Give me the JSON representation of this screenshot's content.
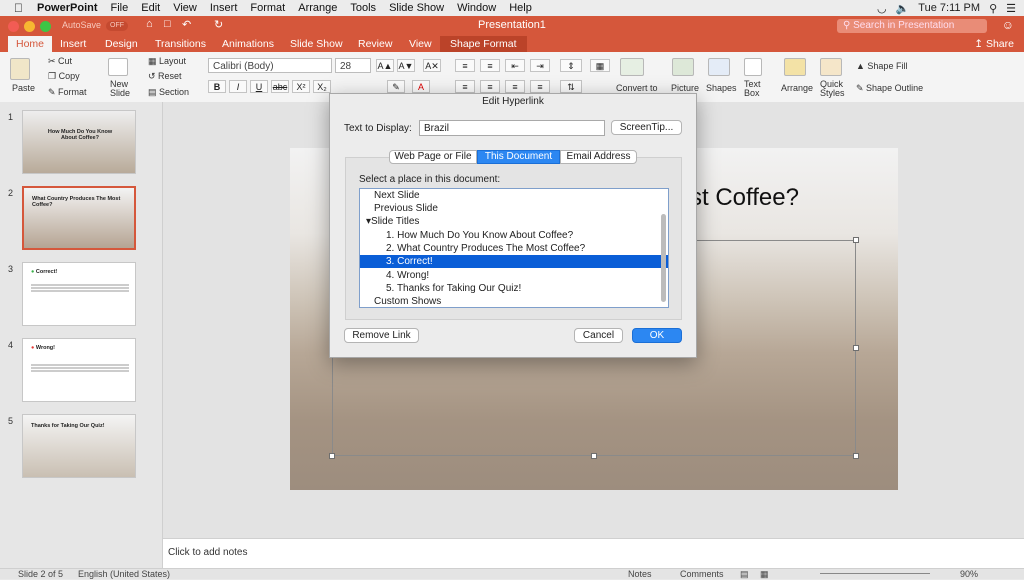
{
  "menubar": {
    "app_name": "PowerPoint",
    "menus": [
      "File",
      "Edit",
      "View",
      "Insert",
      "Format",
      "Arrange",
      "Tools",
      "Slide Show",
      "Window",
      "Help"
    ],
    "clock": "Tue 7:11 PM"
  },
  "titlebar": {
    "autosave_label": "AutoSave",
    "autosave_state": "OFF",
    "title": "Presentation1",
    "search_placeholder": "Search in Presentation"
  },
  "tabs": [
    "Home",
    "Insert",
    "Design",
    "Transitions",
    "Animations",
    "Slide Show",
    "Review",
    "View",
    "Shape Format"
  ],
  "share_label": "Share",
  "ribbon": {
    "paste": "Paste",
    "cut": "Cut",
    "copy": "Copy",
    "format": "Format",
    "new_slide": "New Slide",
    "layout": "Layout",
    "reset": "Reset",
    "section": "Section",
    "font_name": "Calibri (Body)",
    "font_size": "28",
    "convert_to": "Convert to",
    "picture": "Picture",
    "shapes": "Shapes",
    "text_box": "Text Box",
    "arrange": "Arrange",
    "quick_styles": "Quick Styles",
    "shape_fill": "Shape Fill",
    "shape_outline": "Shape Outline"
  },
  "thumbnails": [
    {
      "num": "1",
      "title": "How Much Do You Know About Coffee?"
    },
    {
      "num": "2",
      "title": "What Country Produces The Most Coffee?"
    },
    {
      "num": "3",
      "title": "Correct!"
    },
    {
      "num": "4",
      "title": "Wrong!"
    },
    {
      "num": "5",
      "title": "Thanks for Taking Our Quiz!"
    }
  ],
  "slide": {
    "title_fragment": "st Coffee?"
  },
  "notes_placeholder": "Click to add notes",
  "status": {
    "slide_info": "Slide 2 of 5",
    "language": "English (United States)",
    "notes": "Notes",
    "comments": "Comments",
    "zoom": "90%"
  },
  "dialog": {
    "title": "Edit Hyperlink",
    "text_to_display_label": "Text to Display:",
    "text_to_display_value": "Brazil",
    "screentip_button": "ScreenTip...",
    "tabs": [
      "Web Page or File",
      "This Document",
      "Email Address"
    ],
    "select_label": "Select a place in this document:",
    "list_items": [
      "Next Slide",
      "Previous Slide",
      "Slide Titles",
      "1. How Much Do You Know About Coffee?",
      "2. What Country Produces The Most Coffee?",
      "3. Correct!",
      "4. Wrong!",
      "5. Thanks for Taking Our Quiz!",
      "Custom Shows"
    ],
    "remove_link_button": "Remove Link",
    "cancel_button": "Cancel",
    "ok_button": "OK"
  }
}
